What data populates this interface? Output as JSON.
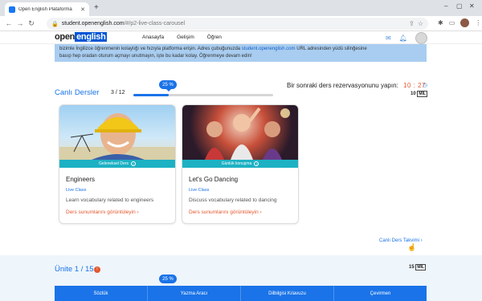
{
  "browser": {
    "tab_title": "Open English Plataforma",
    "new_tab": "+",
    "url_host": "student.openenglish.com",
    "url_path": "/#/p2-live-class-carousel"
  },
  "header": {
    "logo_open": "open",
    "logo_english": "english",
    "nav": [
      "Anasayfa",
      "Gelişim",
      "Öğren"
    ]
  },
  "banner": {
    "line1": "bizimle İngilizce öğrenmenin kolaylığı ve hızıyla platforma erişin. Adres çubuğunuzda",
    "link": "student.openenglish.com",
    "line1b": "URL adresinden yüdü silinğesine",
    "line2": "basıp hep oradan oturum açmayı unutmayın, işte bu kadar kolay. Öğrenmeye devam edin!"
  },
  "live": {
    "title": "Canlı Dersler",
    "counter": "3 / 12",
    "progress_percent": 25,
    "progress_label": "25 %",
    "reservation_text": "Bir sonraki ders rezervasyonunu yapın:",
    "countdown": "10 : 27",
    "mil_value": "10",
    "mil_unit": "MİL"
  },
  "cards": [
    {
      "tag": "Geleneksel Ders",
      "title": "Engineers",
      "type": "Live Class",
      "description": "Learn vocabulary related to engineers",
      "link": "Ders sunumlarını görüntüleyin  ›"
    },
    {
      "tag": "Günlük konuşma",
      "title": "Let's Go Dancing",
      "type": "Live Class",
      "description": "Discuss vocabulary related to dancing",
      "link": "Ders sunumlarını görüntüleyin  ›"
    }
  ],
  "calendar_link": "Canlı Ders Takvimi  ›",
  "unit": {
    "title": "Ünite 1 / 15",
    "badge": "!",
    "mil_value": "15",
    "mil_unit": "MİL",
    "progress_label": "25 %"
  },
  "bottom_tools": [
    "Sözlük",
    "Yazma Aracı",
    "Dilbilgisi Kılavuzu",
    "Çevirmen"
  ],
  "colors": {
    "accent": "#1a73e8",
    "orange": "#e4572e",
    "teal": "#1db1c4",
    "banner": "#a9cdf0"
  }
}
